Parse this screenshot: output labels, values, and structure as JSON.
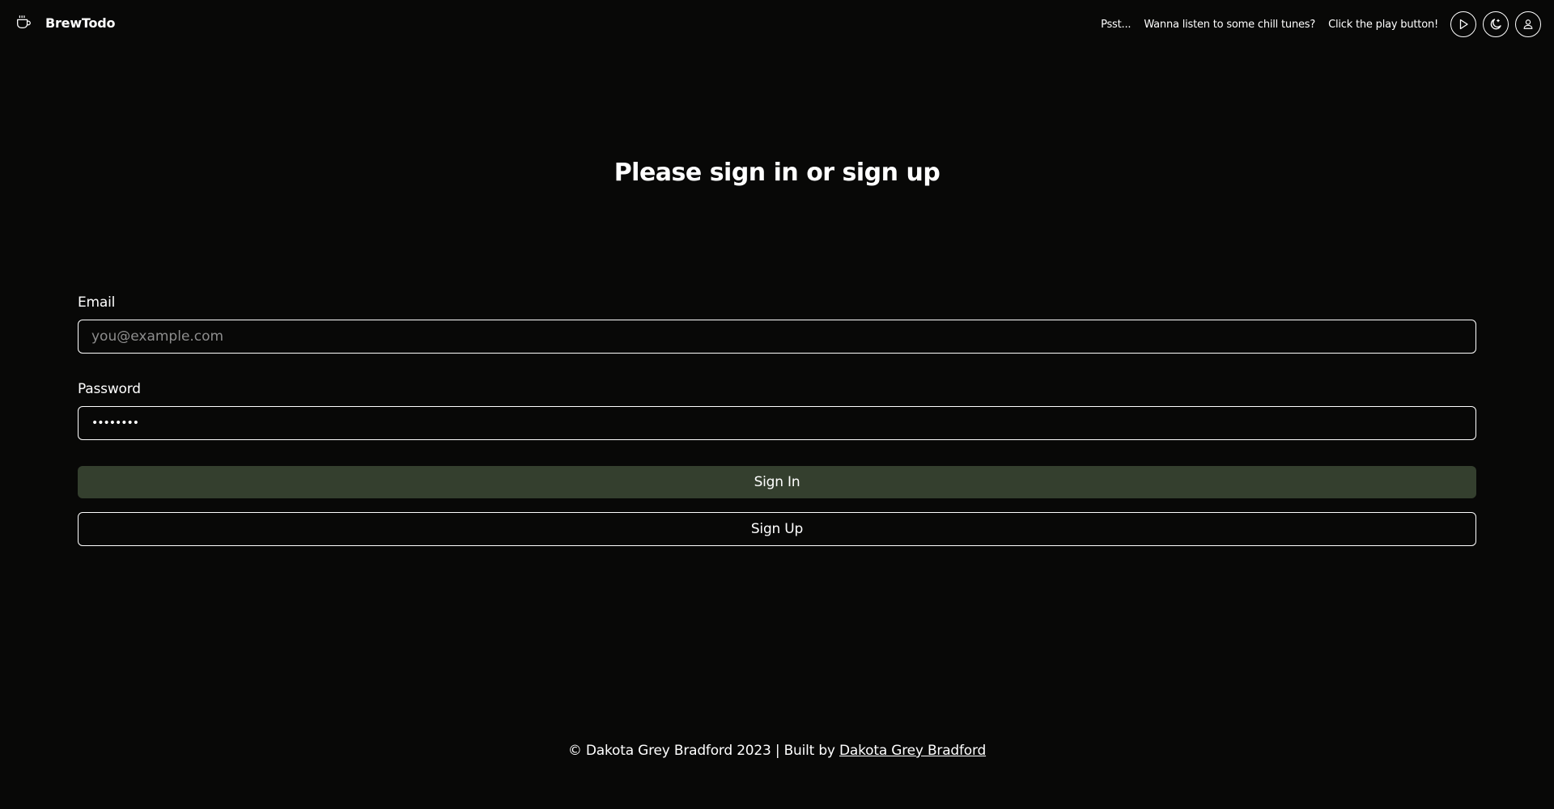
{
  "header": {
    "brand_name": "BrewTodo",
    "brand_icon": "coffee-cup-icon",
    "tips": [
      "Psst...",
      "Wanna listen to some chill tunes?",
      "Click the play button!"
    ],
    "buttons": {
      "play_icon": "play-icon",
      "theme_icon": "moon-icon",
      "account_icon": "user-icon"
    }
  },
  "main": {
    "title": "Please sign in or sign up",
    "email": {
      "label": "Email",
      "placeholder": "you@example.com",
      "value": ""
    },
    "password": {
      "label": "Password",
      "value": "••••••••"
    },
    "sign_in_label": "Sign In",
    "sign_up_label": "Sign Up"
  },
  "footer": {
    "prefix": "© Dakota Grey Bradford 2023 | Built by ",
    "link_text": "Dakota Grey Bradford"
  },
  "colors": {
    "background": "#080807",
    "text": "#ffffff",
    "primary_button": "#343f2e",
    "placeholder": "#8d8d8d"
  }
}
